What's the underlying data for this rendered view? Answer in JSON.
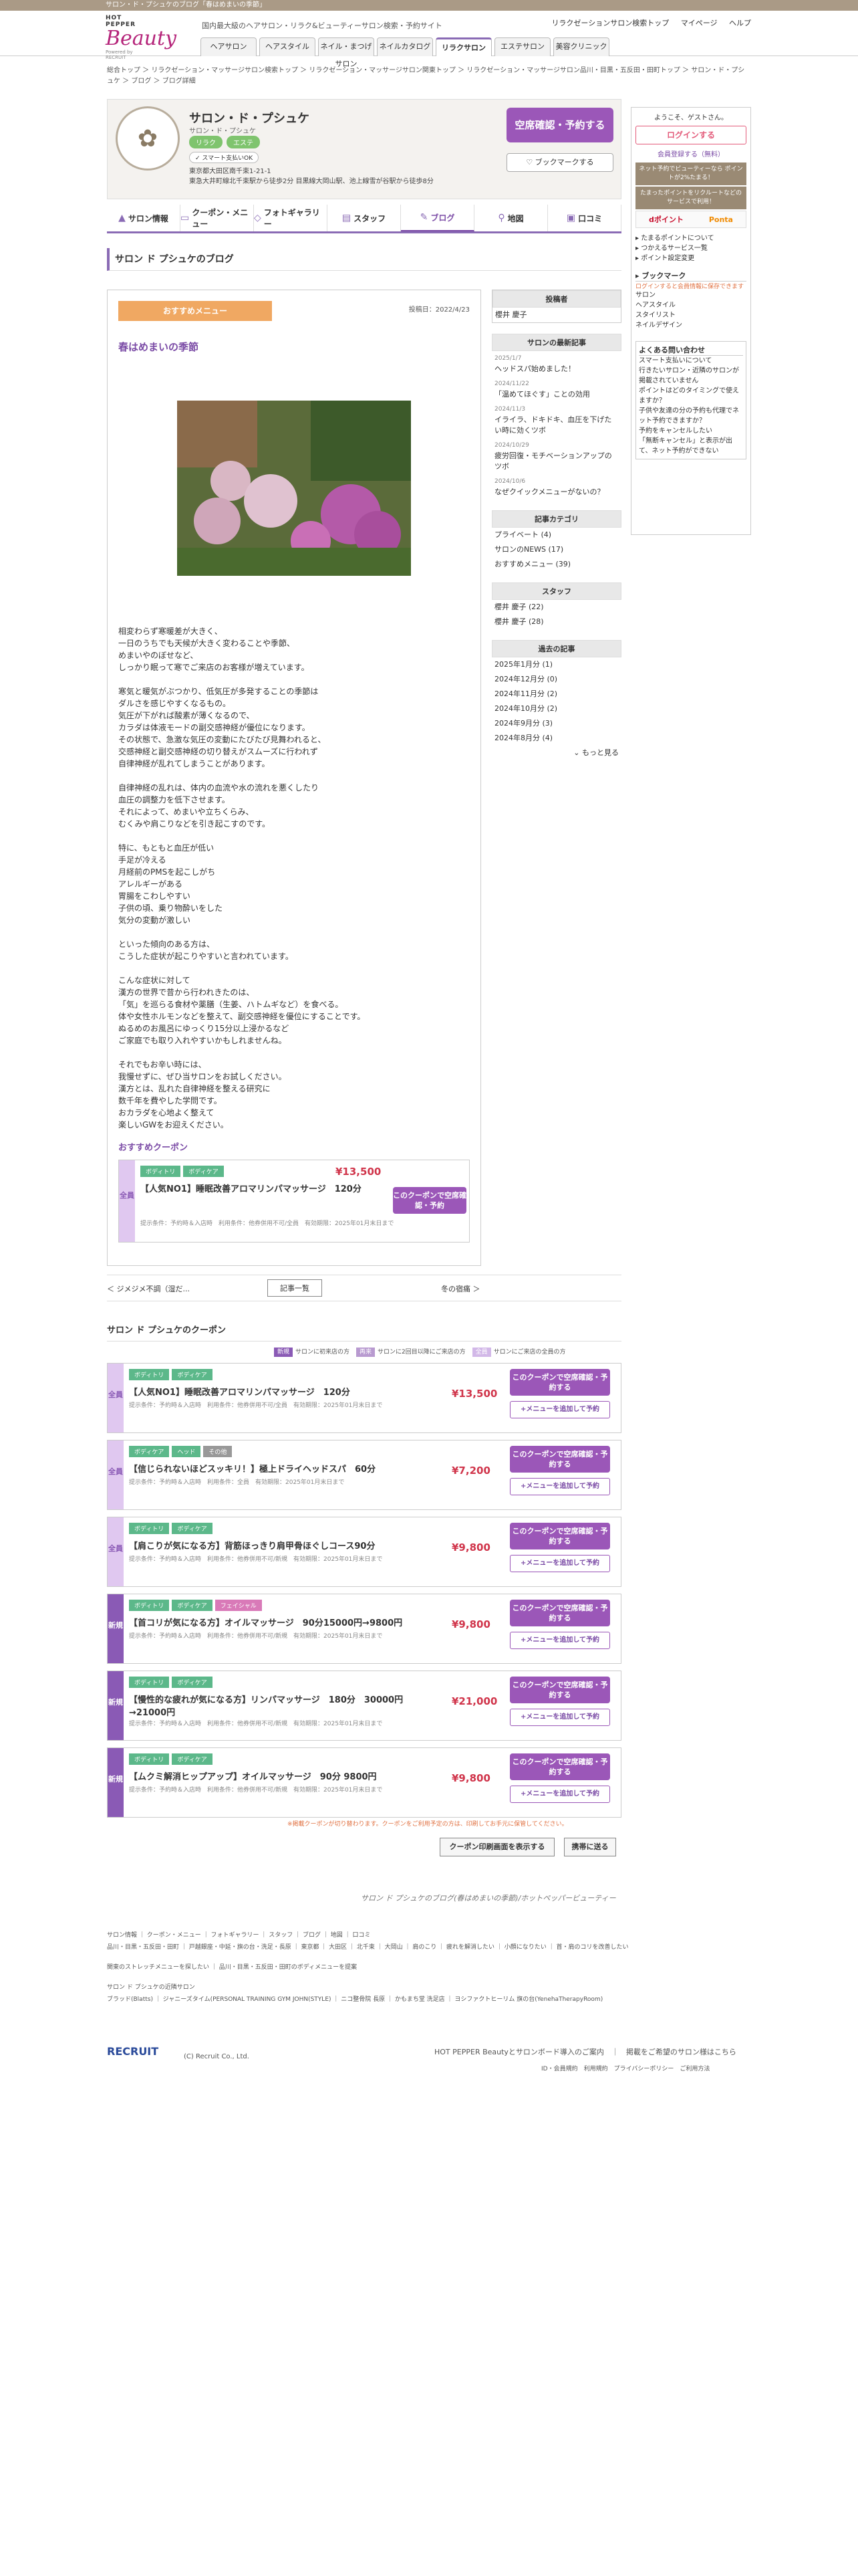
{
  "topbar": "サロン・ド・プシュケのブログ「春はめまいの季節」",
  "logo": {
    "hp": "HOT PEPPER",
    "brand": "Beauty",
    "powered": "Powered by RECRUIT"
  },
  "tagline": "国内最大級のヘアサロン・リラク&ビューティーサロン検索・予約サイト",
  "usernav": [
    "リラクゼーションサロン検索トップ",
    "マイページ",
    "ヘルプ"
  ],
  "gnav": [
    "ヘアサロン",
    "ヘアスタイル",
    "ネイル・まつげサロン",
    "ネイルカタログ",
    "リラクサロン",
    "エステサロン",
    "美容クリニック"
  ],
  "breadcrumb": "総合トップ ＞ リラクゼーション・マッサージサロン検索トップ ＞ リラクゼーション・マッサージサロン関東トップ ＞ リラクゼーション・マッサージサロン品川・目黒・五反田・田町トップ ＞ サロン・ド・プシュケ ＞ ブログ ＞ ブログ詳細",
  "salon": {
    "name": "サロン・ド・プシュケ",
    "kana": "サロン・ド・プシュケ",
    "tags": [
      "リラク",
      "エステ"
    ],
    "smart": "スマート支払いOK",
    "addr1": "東京都大田区南千束1-21-1",
    "addr2": "東急大井町線北千束駅から徒歩2分 目黒線大岡山駅、池上線雪が谷駅から徒歩8分",
    "book": "空席確認・予約する",
    "bookmark": "ブックマークする"
  },
  "tabs": [
    "サロン情報",
    "クーポン・メニュー",
    "フォトギャラリー",
    "スタッフ",
    "ブログ",
    "地図",
    "口コミ"
  ],
  "blog": {
    "heading": "サロン ド プシュケのブログ",
    "reco": "おすすめメニュー",
    "date": "投稿日：2022/4/23",
    "title": "春はめまいの季節",
    "body": "相変わらず寒暖差が大きく、\n一日のうちでも天候が大きく変わることや季節、\nめまいやのぼせなど、\nしっかり眠って寒でご来店のお客様が増えています。\n\n寒気と暖気がぶつかり、低気圧が多発することの季節は\nダルさを感じやすくなるもの。\n気圧が下がれば酸素が薄くなるので、\nカラダは体液モードの副交感神経が優位になります。\nその状態で、急激な気圧の変動にたびたび見舞われると、\n交感神経と副交感神経の切り替えがスムーズに行われず\n自律神経が乱れてしまうことがあります。\n\n自律神経の乱れは、体内の血流や水の流れを悪くしたり\n血圧の調整力を低下させます。\nそれによって、めまいや立ちくらみ、\nむくみや肩こりなどを引き起こすのです。\n\n特に、もともと血圧が低い\n手足が冷える\n月経前のPMSを起こしがち\nアレルギーがある\n胃腸をこわしやすい\n子供の頃、乗り物酔いをした\n気分の変動が激しい\n\nといった傾向のある方は、\nこうした症状が起こりやすいと言われています。\n\nこんな症状に対して\n漢方の世界で昔から行われきたのは、\n「気」を巡らる食材や薬膳（生姜、ハトムギなど）を食べる。\n体や女性ホルモンなどを整えて、副交感神経を優位にすることです。\nぬるめのお風呂にゆっくり15分以上浸かるなど\nご家庭でも取り入れやすいかもしれませんね。\n\nそれでもお辛い時には、\n我慢せずに、ぜひ当サロンをお試しください。\n漢方とは、乱れた自律神経を整える研究に\n数千年を費やした学問です。\nおカラダを心地よく整えて\n楽しいGWをお迎えください。",
    "coupsect": "おすすめクーポン",
    "coupon": {
      "side": "全員",
      "tags": [
        "ボディトリ",
        "ボディケア"
      ],
      "name": "【人気NO1】睡眠改善アロマリンパマッサージ　120分",
      "price": "¥13,500",
      "cond": "提示条件：予約時＆入店時　利用条件：他券併用不可/全員　有効期限：2025年01月末日まで",
      "btn": "このクーポンで空席確認・予約"
    },
    "prev": "＜ ジメジメ不調（湿だ...",
    "list": "記事一覧",
    "next": "冬の宿痛 ＞"
  },
  "side": {
    "author_head": "投稿者",
    "author": "櫻井 慶子",
    "recent_head": "サロンの最新記事",
    "recent": [
      {
        "date": "2025/1/7",
        "t": "ヘッドスパ始めました！"
      },
      {
        "date": "2024/11/22",
        "t": "「温めてほぐす」ことの効用"
      },
      {
        "date": "2024/11/3",
        "t": "イライラ、ドキドキ、血圧を下げたい時に効くツボ"
      },
      {
        "date": "2024/10/29",
        "t": "疲労回復・モチベーションアップのツボ"
      },
      {
        "date": "2024/10/6",
        "t": "なぜクイックメニューがないの？"
      }
    ],
    "cat_head": "記事カテゴリ",
    "cats": [
      "プライベート (4)",
      "サロンのNEWS (17)",
      "おすすめメニュー (39)"
    ],
    "staff_head": "スタッフ",
    "staff": [
      "櫻井 慶子 (22)",
      "櫻井 慶子 (28)"
    ],
    "past_head": "過去の記事",
    "past": [
      "2025年1月分 (1)",
      "2024年12月分 (0)",
      "2024年11月分 (2)",
      "2024年10月分 (2)",
      "2024年9月分 (3)",
      "2024年8月分 (4)"
    ],
    "more": "もっと見る"
  },
  "coupons_head": "サロン ド プシュケのクーポン",
  "legend": [
    {
      "k": "新規",
      "t": "サロンに初来店の方"
    },
    {
      "k": "再来",
      "t": "サロンに2回目以降にご来店の方"
    },
    {
      "k": "全員",
      "t": "サロンにご来店の全員の方"
    }
  ],
  "coupons": [
    {
      "side": "全員",
      "tags": [
        "ボディトリ",
        "ボディケア"
      ],
      "name": "【人気NO1】睡眠改善アロマリンパマッサージ　120分",
      "price": "¥13,500",
      "meta": "提示条件：予約時＆入店時　利用条件：他券併用不可/全員　有効期限：2025年01月末日まで"
    },
    {
      "side": "全員",
      "tags": [
        "ボディケア",
        "ヘッド",
        "その他"
      ],
      "name": "【信じられないほどスッキリ！】極上ドライヘッドスパ　60分",
      "price": "¥7,200",
      "meta": "提示条件：予約時＆入店時　利用条件：全員　有効期限：2025年01月末日まで"
    },
    {
      "side": "全員",
      "tags": [
        "ボディトリ",
        "ボディケア"
      ],
      "name": "【肩こりが気になる方】背筋ほっきり肩甲骨ほぐしコース90分",
      "price": "¥9,800",
      "meta": "提示条件：予約時＆入店時　利用条件：他券併用不可/新規　有効期限：2025年01月末日まで"
    },
    {
      "side": "新規",
      "tags": [
        "ボディトリ",
        "ボディケア",
        "フェイシャル"
      ],
      "name": "【首コリが気になる方】オイルマッサージ　90分15000円→9800円",
      "price": "¥9,800",
      "meta": "提示条件：予約時＆入店時　利用条件：他券併用不可/新規　有効期限：2025年01月末日まで"
    },
    {
      "side": "新規",
      "tags": [
        "ボディトリ",
        "ボディケア"
      ],
      "name": "【慢性的な疲れが気になる方】リンパマッサージ　180分　30000円→21000円",
      "price": "¥21,000",
      "meta": "提示条件：予約時＆入店時　利用条件：他券併用不可/新規　有効期限：2025年01月末日まで"
    },
    {
      "side": "新規",
      "tags": [
        "ボディトリ",
        "ボディケア"
      ],
      "name": "【ムクミ解消ヒップアップ】オイルマッサージ　90分 9800円",
      "price": "¥9,800",
      "meta": "提示条件：予約時＆入店時　利用条件：他券併用不可/新規　有効期限：2025年01月末日まで"
    }
  ],
  "coupon_btn": "このクーポンで空席確認・予約する",
  "coupon_add": "+メニューを追加して予約",
  "note": "※掲載クーポンが切り替わります。クーポンをご利用予定の方は、印刷してお手元に保管してください。",
  "print": "クーポン印刷画面を表示する",
  "mobile": "携帯に送る",
  "footer_title": "サロン ド プシュケのブログ(春はめまいの季節)/ホットペッパービューティー",
  "right": {
    "welcome": "ようこそ、ゲストさん。",
    "login": "ログインする",
    "reg": "会員登録する（無料）",
    "promo1": "ネット予約でビューティーなら ポイントが2%たまる！",
    "promo2": "たまったポイントをリクルートなどのサービスで利用！",
    "pointA": "Ponta",
    "pointB": "dポイント",
    "links": [
      "たまるポイントについて",
      "つかえるサービス一覧",
      "ポイント設定変更"
    ],
    "bmhead": "ブックマーク",
    "bmnote": "ログインすると会員情報に保存できます",
    "bm": [
      "サロン",
      "ヘアスタイル",
      "スタイリスト",
      "ネイルデザイン"
    ],
    "faq_head": "よくある問い合わせ",
    "faq": [
      "スマート支払いについて",
      "行きたいサロン・近隣のサロンが掲載されていません",
      "ポイントはどのタイミングで使えますか？",
      "子供や友達の分の予約も代理でネット予約できますか？",
      "予約をキャンセルしたい",
      "「無断キャンセル」と表示が出て、ネット予約ができない"
    ]
  },
  "footer_links": [
    "サロン情報",
    "クーポン・メニュー",
    "フォトギャラリー",
    "スタッフ",
    "ブログ",
    "地図",
    "口コミ"
  ],
  "footer_area": "品川・目黒・五反田・田町 ｜ 戸越銀座・中延・旗の台・洗足・長原 ｜ 東京都 ｜ 大田区 ｜ 北千束 ｜ 大岡山 ｜ 肩のこり ｜ 疲れを解消したい ｜ 小顔になりたい ｜ 首・肩のコリを改善したい",
  "footer_extra": "関東のストレッチメニューを探したい ｜ 品川・目黒・五反田・田町のボディメニューを提案",
  "footer_near": "サロン ド プシュケの近隣サロン",
  "footer_near_list": "ブラッド(Blatts) ｜ ジャニーズタイム(PERSONAL TRAINING GYM JOHN(STYLE) ｜ ニコ整骨院 長原 ｜ かもまち堂 洗足店 ｜ ヨシファクトヒーリム 旗の台(YenehaTherapyRoom)",
  "recruit": "RECRUIT",
  "copy": "(C) Recruit Co., Ltd.",
  "footr": "HOT PEPPER Beautyとサロンボード導入のご案内　｜　掲載をご希望のサロン様はこちら",
  "footr2": "ID・会員規約　利用規約　プライバシーポリシー　ご利用方法"
}
